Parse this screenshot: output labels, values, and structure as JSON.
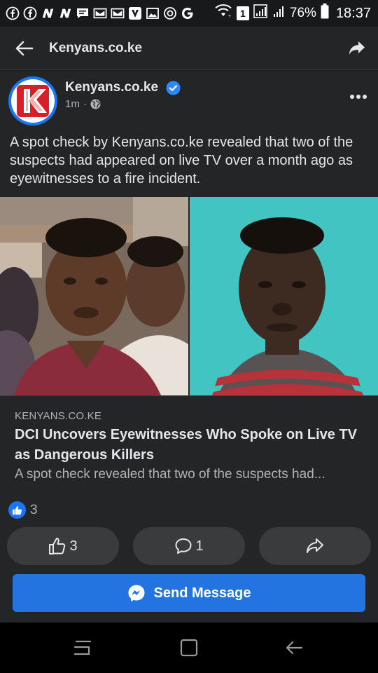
{
  "status_bar": {
    "battery_percent": "76%",
    "time": "18:37",
    "sim_label": "1",
    "notification_icons": [
      "facebook-icon",
      "facebook-icon",
      "n-app-icon",
      "n-app-icon",
      "message-icon",
      "mail-icon",
      "mail-icon",
      "v-app-icon",
      "gallery-icon",
      "circle-app-icon",
      "google-icon"
    ]
  },
  "app_bar": {
    "title": "Kenyans.co.ke"
  },
  "post": {
    "page_name": "Kenyans.co.ke",
    "time_ago": "1m",
    "separator": "·",
    "text": "A spot check by Kenyans.co.ke revealed that two of the suspects had appeared on live TV over a month ago as eyewitnesses to a fire incident.",
    "avatar_letter": "K",
    "link_preview": {
      "domain": "KENYANS.CO.KE",
      "title": "DCI Uncovers Eyewitnesses Who Spoke on Live TV as Dangerous Killers",
      "description": "A spot check revealed that two of the suspects had..."
    },
    "reaction_count": "3",
    "actions": {
      "like_count": "3",
      "comment_count": "1"
    }
  },
  "send_message": {
    "label": "Send Message"
  },
  "colors": {
    "background": "#18191a",
    "card": "#242526",
    "button": "#3a3b3c",
    "accent_blue": "#2374e1",
    "text_primary": "#e4e6eb",
    "text_secondary": "#b0b3b8"
  }
}
